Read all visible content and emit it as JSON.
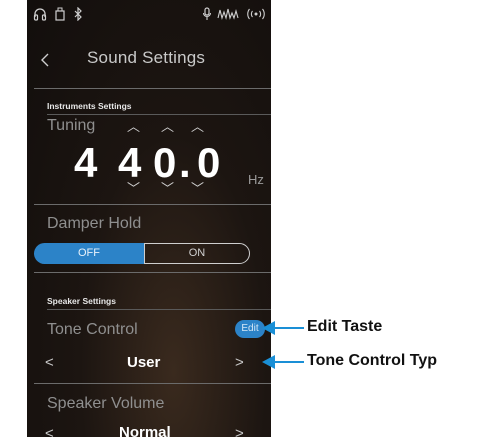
{
  "status_bar": {
    "icons": [
      "headphones-icon",
      "usb-icon",
      "bluetooth-icon",
      "mic-icon",
      "vu-meter-icon",
      "wireless-icon"
    ]
  },
  "header": {
    "back_glyph": "<",
    "title": "Sound Settings"
  },
  "instruments_settings": {
    "section_label": "Instruments Settings",
    "tuning": {
      "label": "Tuning",
      "digits": [
        "4",
        "4",
        "0",
        ".",
        "0"
      ],
      "unit": "Hz"
    },
    "damper_hold": {
      "label": "Damper Hold",
      "off_label": "OFF",
      "on_label": "ON",
      "selected": "OFF"
    }
  },
  "speaker_settings": {
    "section_label": "Speaker Settings",
    "tone_control": {
      "label": "Tone Control",
      "edit_label": "Edit",
      "prev_glyph": "<",
      "value": "User",
      "next_glyph": ">"
    },
    "speaker_volume": {
      "label": "Speaker Volume",
      "prev_glyph": "<",
      "value": "Normal",
      "next_glyph": ">"
    }
  },
  "annotations": {
    "edit_taste": "Edit Taste",
    "tone_control_typ": "Tone Control Typ"
  },
  "colors": {
    "accent": "#2c83c8",
    "annotation_arrow": "#1a8fd6",
    "background": "#1c1511"
  }
}
